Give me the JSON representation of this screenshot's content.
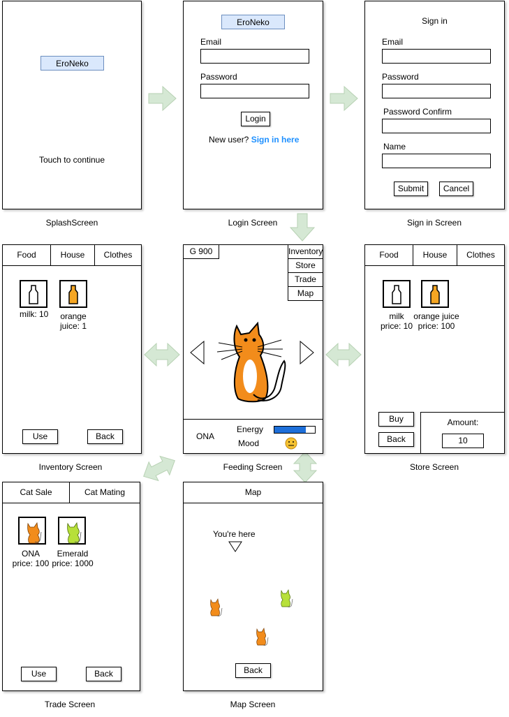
{
  "app_name": "EroNeko",
  "colors": {
    "arrow_fill": "#d5e8d4",
    "arrow_stroke": "#b7d1b3",
    "link": "#1e90ff",
    "logo_fill": "#dae8fc",
    "energy_bar": "#1e6fd9",
    "cat_orange": "#f28c1b",
    "cat_green": "#b7e03a",
    "juice": "#f5a623"
  },
  "splash": {
    "logo": "EroNeko",
    "prompt": "Touch to continue",
    "caption": "SplashScreen"
  },
  "login": {
    "logo": "EroNeko",
    "email_label": "Email",
    "password_label": "Password",
    "login_button": "Login",
    "new_user_text": "New user?",
    "signin_link": "Sign in here",
    "caption": "Login Screen"
  },
  "signin": {
    "title": "Sign in",
    "email_label": "Email",
    "password_label": "Password",
    "password_confirm_label": "Password Confirm",
    "name_label": "Name",
    "submit_button": "Submit",
    "cancel_button": "Cancel",
    "caption": "Sign in Screen"
  },
  "inventory": {
    "tabs": [
      "Food",
      "House",
      "Clothes"
    ],
    "items": [
      {
        "label_line1": "milk: 10",
        "label_line2": "",
        "icon": "milk-bottle-icon"
      },
      {
        "label_line1": "orange",
        "label_line2": "juice: 1",
        "icon": "orange-juice-icon"
      }
    ],
    "use_button": "Use",
    "back_button": "Back",
    "caption": "Inventory Screen"
  },
  "feeding": {
    "gold": "G 900",
    "menu": [
      "Inventory",
      "Store",
      "Trade",
      "Map"
    ],
    "cat_name": "ONA",
    "energy_label": "Energy",
    "mood_label": "Mood",
    "energy_level": 0.78,
    "caption": "Feeding Screen"
  },
  "store": {
    "tabs": [
      "Food",
      "House",
      "Clothes"
    ],
    "items": [
      {
        "name": "milk",
        "price": "price: 10",
        "icon": "milk-bottle-icon"
      },
      {
        "name": "orange juice",
        "price": "price: 100",
        "icon": "orange-juice-icon"
      }
    ],
    "buy_button": "Buy",
    "back_button": "Back",
    "amount_label": "Amount:",
    "amount_value": "10",
    "caption": "Store Screen"
  },
  "trade": {
    "tabs": [
      "Cat Sale",
      "Cat Mating"
    ],
    "items": [
      {
        "name": "ONA",
        "price": "price: 100",
        "icon": "orange-cat-icon"
      },
      {
        "name": "Emerald",
        "price": "price: 1000",
        "icon": "green-cat-icon"
      }
    ],
    "use_button": "Use",
    "back_button": "Back",
    "caption": "Trade Screen"
  },
  "map": {
    "title": "Map",
    "here_label": "You're here",
    "back_button": "Back",
    "caption": "Map Screen"
  }
}
